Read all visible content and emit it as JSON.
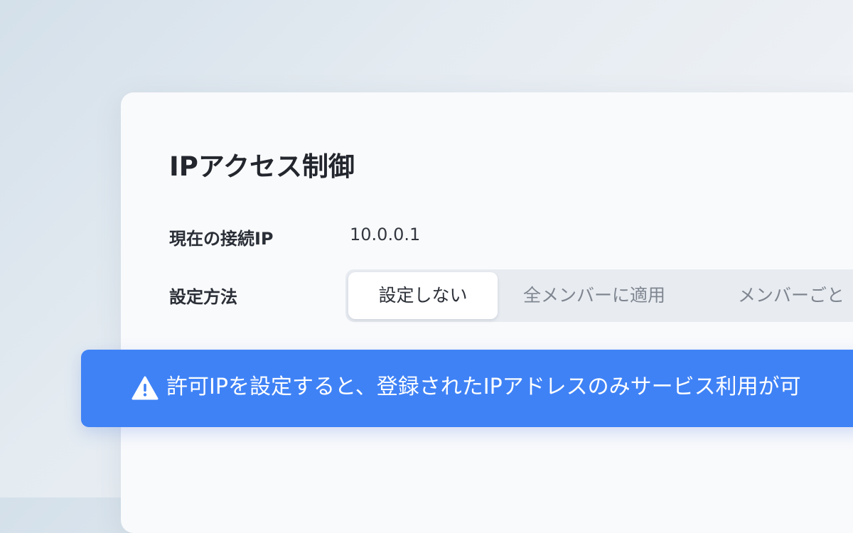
{
  "card": {
    "title": "IPアクセス制御",
    "current_ip": {
      "label": "現在の接続IP",
      "value": "10.0.0.1"
    },
    "method": {
      "label": "設定方法",
      "options": [
        {
          "label": "設定しない",
          "selected": true
        },
        {
          "label": "全メンバーに適用",
          "selected": false
        },
        {
          "label": "メンバーごと",
          "selected": false
        }
      ]
    }
  },
  "alert": {
    "icon": "warning-icon",
    "message": "許可IPを設定すると、登録されたIPアドレスのみサービス利用が可",
    "background_color": "#3f82f6"
  }
}
